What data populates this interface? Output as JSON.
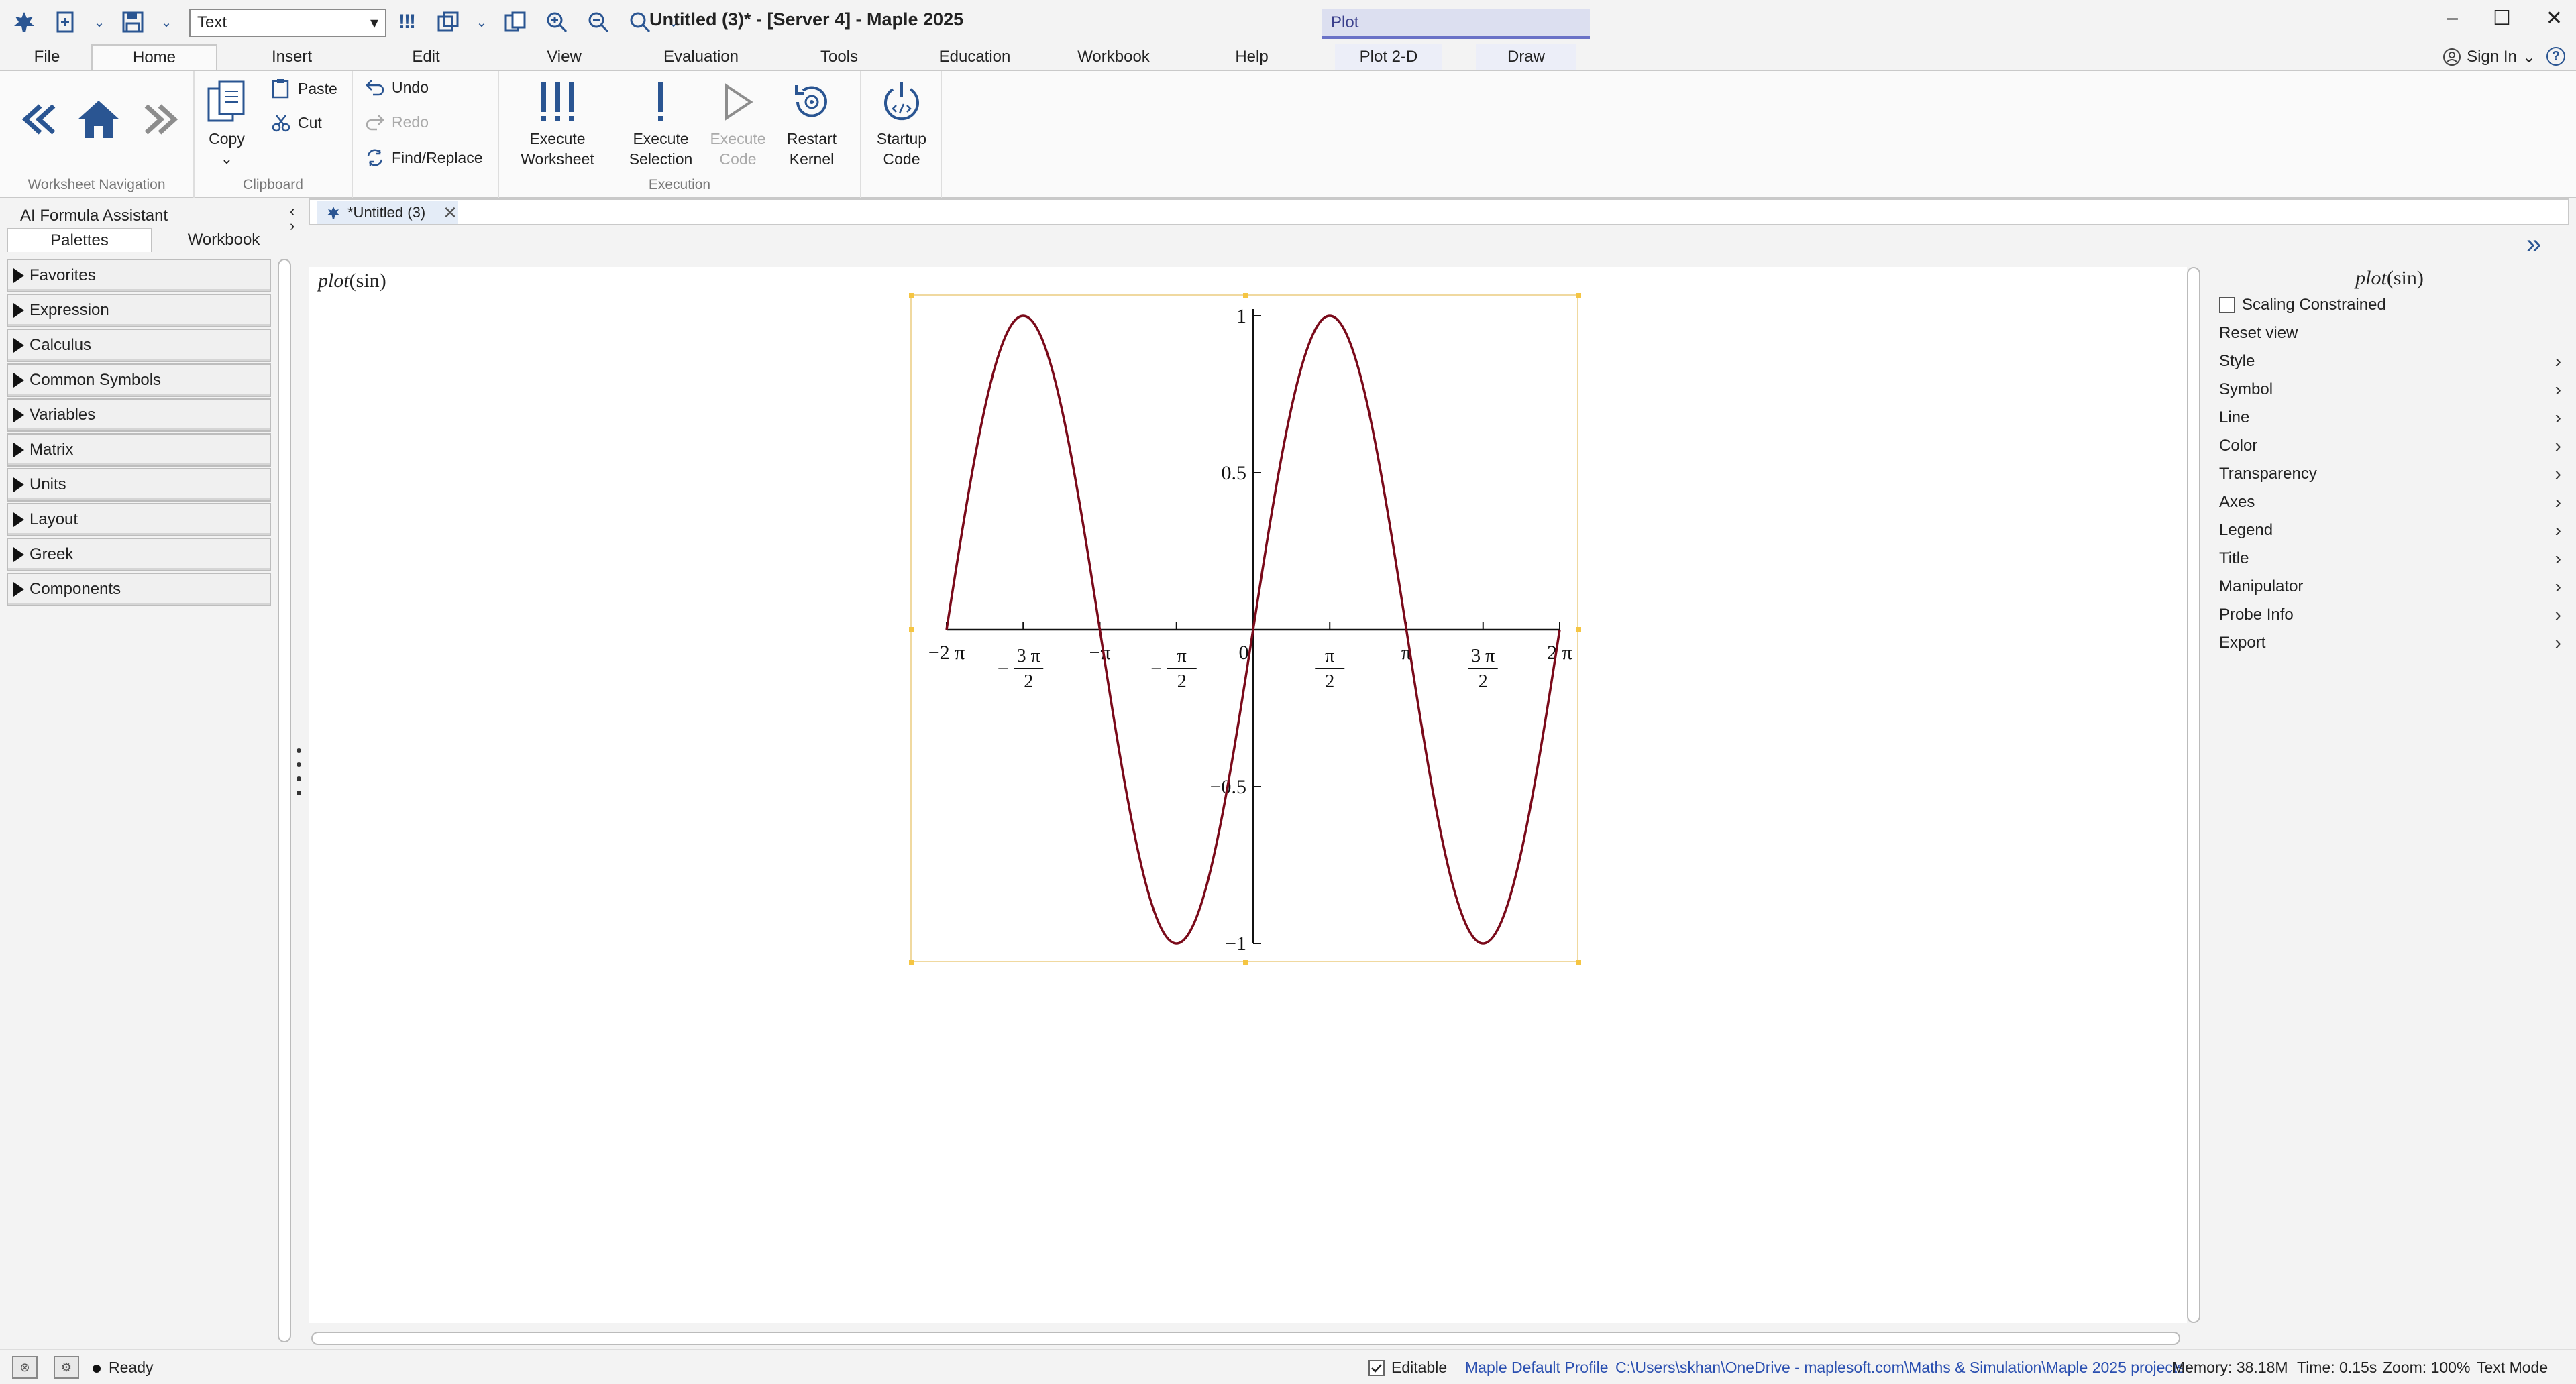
{
  "window": {
    "title": "Untitled (3)* - [Server 4] - Maple 2025",
    "style_select_value": "Text",
    "context_tab_head": "Plot"
  },
  "ribbon_tabs": [
    "File",
    "Home",
    "Insert",
    "Edit",
    "View",
    "Evaluation",
    "Tools",
    "Education",
    "Workbook",
    "Help",
    "Plot 2-D",
    "Draw"
  ],
  "sign_in": "Sign In",
  "help_glyph": "?",
  "ribbon": {
    "nav_group": "Worksheet Navigation",
    "clipboard_group": "Clipboard",
    "execution_group": "Execution",
    "copy": "Copy",
    "paste": "Paste",
    "cut": "Cut",
    "undo": "Undo",
    "redo": "Redo",
    "find_replace": "Find/Replace",
    "execute_worksheet": [
      "Execute",
      "Worksheet"
    ],
    "execute_selection": [
      "Execute",
      "Selection"
    ],
    "execute_code": [
      "Execute",
      "Code"
    ],
    "restart_kernel": [
      "Restart",
      "Kernel"
    ],
    "startup_code": [
      "Startup",
      "Code"
    ]
  },
  "left_panel": {
    "title": "AI Formula Assistant",
    "tabs": [
      "Palettes",
      "Workbook"
    ],
    "palettes": [
      "Favorites",
      "Expression",
      "Calculus",
      "Common Symbols",
      "Variables",
      "Matrix",
      "Units",
      "Layout",
      "Greek",
      "Components"
    ]
  },
  "doc_tab": "*Untitled (3)",
  "worksheet": {
    "input_fn": "plot",
    "input_arg": "sin"
  },
  "right_panel": {
    "title_fn": "plot",
    "title_arg": "sin",
    "scaling_constrained": "Scaling Constrained",
    "reset_view": "Reset view",
    "menu": [
      "Style",
      "Symbol",
      "Line",
      "Color",
      "Transparency",
      "Axes",
      "Legend",
      "Title",
      "Manipulator",
      "Probe Info",
      "Export"
    ]
  },
  "chart_data": {
    "type": "line",
    "function": "sin",
    "xlim": [
      "-2π",
      "2π"
    ],
    "ylim": [
      -1,
      1
    ],
    "x_ticks": [
      "−2 π",
      "−3π/2",
      "−π",
      "−π/2",
      "0",
      "π/2",
      "π",
      "3π/2",
      "2 π"
    ],
    "y_ticks": [
      "1",
      "0.5",
      "−0.5",
      "−1"
    ],
    "series_color": "#7a0a1a",
    "grid": false
  },
  "status": {
    "ready": "Ready",
    "editable": "Editable",
    "profile": "Maple Default Profile",
    "path": "C:\\Users\\skhan\\OneDrive - maplesoft.com\\Maths & Simulation\\Maple 2025 projects",
    "memory": "Memory: 38.18M",
    "time": "Time: 0.15s",
    "zoom": "Zoom: 100%",
    "mode": "Text Mode"
  }
}
